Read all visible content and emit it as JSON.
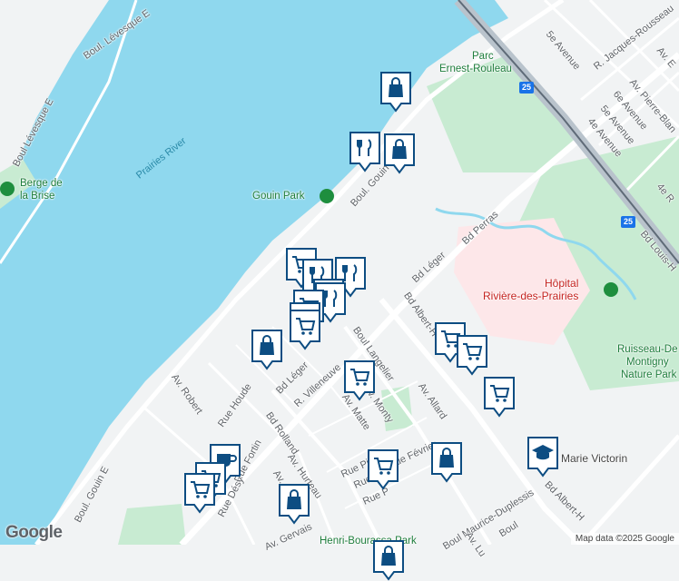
{
  "labels": {
    "water": [
      "Prairies River"
    ],
    "parks": [
      "Parc",
      "Ernest-Rouleau",
      "Gouin Park",
      "Berge de",
      "la Brise"
    ],
    "hospital": [
      "Hôpital",
      "Rivière-des-Prairies"
    ],
    "nature": [
      "Ruisseau-De",
      "Montigny",
      "Nature Park"
    ],
    "roads": [
      "Boul. Lévesque E",
      "Boul Lévesque E",
      "5e Avenue",
      "R. Jacques-Rousseau",
      "Av. Pierre-Blan",
      "6e Avenue",
      "5e Avenue",
      "4e Avenue",
      "Bd Louis-H",
      "Boul. Gouin E",
      "Bd Léger",
      "Bd Perras",
      "Bd Albert-H",
      "Boul Langelier",
      "Av. Allard",
      "Av. Robert",
      "Rue Houde",
      "Bd Léger",
      "R. Villeneuve",
      "Bd Rolland",
      "Av. Monty",
      "Av. Matte",
      "Av. Hurteau",
      "Rue Pierre",
      "Rue Fortin",
      "Rue Désy",
      "Boul. Gouin E",
      "Bd Albert-H",
      "Boul Maurice-Duplessis",
      "Rue Pierre",
      "Rue Février",
      "Av.",
      "4e R",
      "Av. E",
      "Marie Victorin",
      "Henri-Bourassa Park",
      "Av. Lu",
      "Boul",
      "Av. Gervais",
      "Rue P"
    ]
  },
  "highway_shields": [
    "25",
    "25"
  ],
  "markers": [
    {
      "type": "shopping-bag"
    },
    {
      "type": "restaurant"
    },
    {
      "type": "shopping-bag"
    },
    {
      "type": "grocery-cart"
    },
    {
      "type": "restaurant"
    },
    {
      "type": "restaurant"
    },
    {
      "type": "restaurant"
    },
    {
      "type": "restaurant"
    },
    {
      "type": "grocery-cart"
    },
    {
      "type": "grocery-cart"
    },
    {
      "type": "grocery-cart"
    },
    {
      "type": "shopping-bag"
    },
    {
      "type": "grocery-cart"
    },
    {
      "type": "grocery-cart"
    },
    {
      "type": "grocery-cart"
    },
    {
      "type": "grocery-cart"
    },
    {
      "type": "school"
    },
    {
      "type": "grocery-cart"
    },
    {
      "type": "shopping-bag"
    },
    {
      "type": "cafe"
    },
    {
      "type": "grocery-cart"
    },
    {
      "type": "grocery-cart"
    },
    {
      "type": "shopping-bag"
    },
    {
      "type": "shopping-bag"
    }
  ],
  "footer": {
    "logo": "Google",
    "attribution": "Map data ©2025 Google"
  },
  "colors": {
    "water": "#8fd8ee",
    "land": "#f1f3f4",
    "park": "#c8ebd2",
    "hospital": "#fde7e9",
    "marker_blue": "#0d4d82",
    "road": "#ffffff",
    "highway": "#b9c3cc"
  }
}
